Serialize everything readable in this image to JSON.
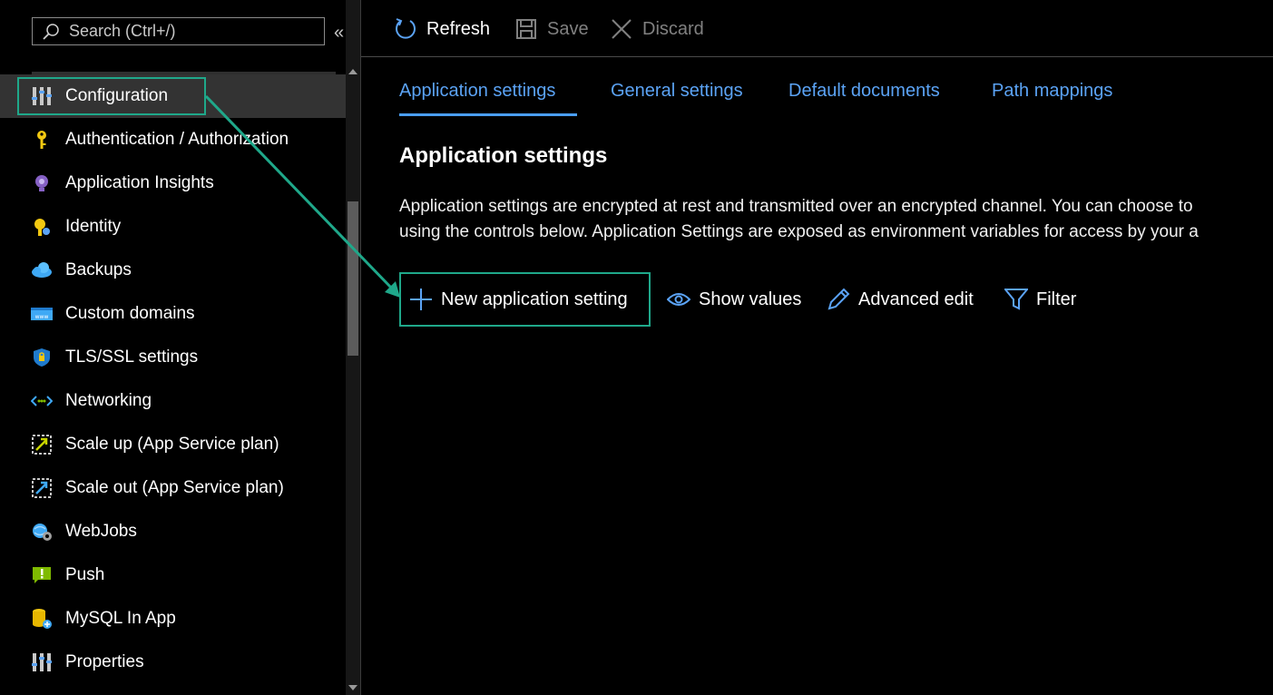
{
  "search": {
    "placeholder": "Search (Ctrl+/)",
    "collapse_glyph": "«"
  },
  "sidebar": {
    "items": [
      {
        "label": "Configuration",
        "icon": "configuration-icon",
        "active": true
      },
      {
        "label": "Authentication / Authorization",
        "icon": "key-icon"
      },
      {
        "label": "Application Insights",
        "icon": "lightbulb-icon"
      },
      {
        "label": "Identity",
        "icon": "identity-icon"
      },
      {
        "label": "Backups",
        "icon": "cloud-icon"
      },
      {
        "label": "Custom domains",
        "icon": "www-icon"
      },
      {
        "label": "TLS/SSL settings",
        "icon": "shield-icon"
      },
      {
        "label": "Networking",
        "icon": "networking-icon"
      },
      {
        "label": "Scale up (App Service plan)",
        "icon": "scale-up-icon"
      },
      {
        "label": "Scale out (App Service plan)",
        "icon": "scale-out-icon"
      },
      {
        "label": "WebJobs",
        "icon": "webjobs-icon"
      },
      {
        "label": "Push",
        "icon": "push-icon"
      },
      {
        "label": "MySQL In App",
        "icon": "mysql-icon"
      },
      {
        "label": "Properties",
        "icon": "properties-icon"
      }
    ]
  },
  "toolbar": {
    "refresh_label": "Refresh",
    "save_label": "Save",
    "discard_label": "Discard"
  },
  "tabs": [
    {
      "label": "Application settings",
      "active": true
    },
    {
      "label": "General settings"
    },
    {
      "label": "Default documents"
    },
    {
      "label": "Path mappings"
    }
  ],
  "section": {
    "title": "Application settings",
    "description_line1": "Application settings are encrypted at rest and transmitted over an encrypted channel. You can choose to",
    "description_line2": "using the controls below. Application Settings are exposed as environment variables for access by your a"
  },
  "actions": {
    "new_setting_label": "New application setting",
    "show_values_label": "Show values",
    "advanced_edit_label": "Advanced edit",
    "filter_label": "Filter"
  },
  "colors": {
    "accent": "#5ba3f5",
    "highlight": "#1fa88a",
    "background": "#000000"
  }
}
